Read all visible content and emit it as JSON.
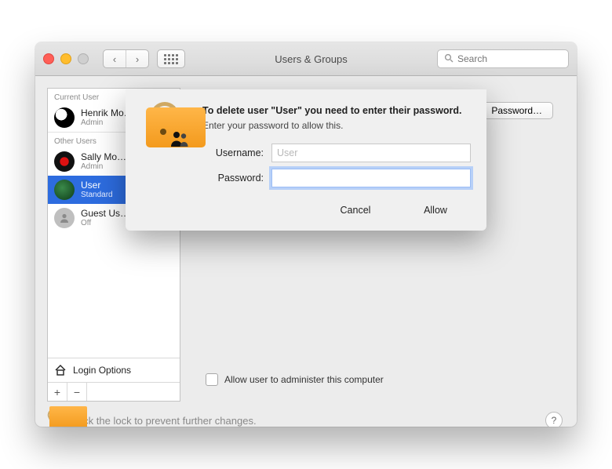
{
  "window": {
    "title": "Users & Groups",
    "search_placeholder": "Search"
  },
  "sidebar": {
    "sections": {
      "current": "Current User",
      "other": "Other Users"
    },
    "items": [
      {
        "name": "Henrik Mo…",
        "sub": "Admin"
      },
      {
        "name": "Sally Mo…",
        "sub": "Admin"
      },
      {
        "name": "User",
        "sub": "Standard"
      },
      {
        "name": "Guest Us…",
        "sub": "Off"
      }
    ],
    "login_options": "Login Options",
    "add_label": "+",
    "remove_label": "−"
  },
  "content": {
    "change_password_label": "Password…",
    "admin_checkbox_label": "Allow user to administer this computer"
  },
  "footer": {
    "lock_text": "Click the lock to prevent further changes.",
    "help_label": "?"
  },
  "dialog": {
    "title": "To delete user \"User\" you need to enter their password.",
    "subtitle": "Enter your password to allow this.",
    "username_label": "Username:",
    "username_value": "User",
    "password_label": "Password:",
    "password_value": "",
    "cancel": "Cancel",
    "allow": "Allow"
  }
}
